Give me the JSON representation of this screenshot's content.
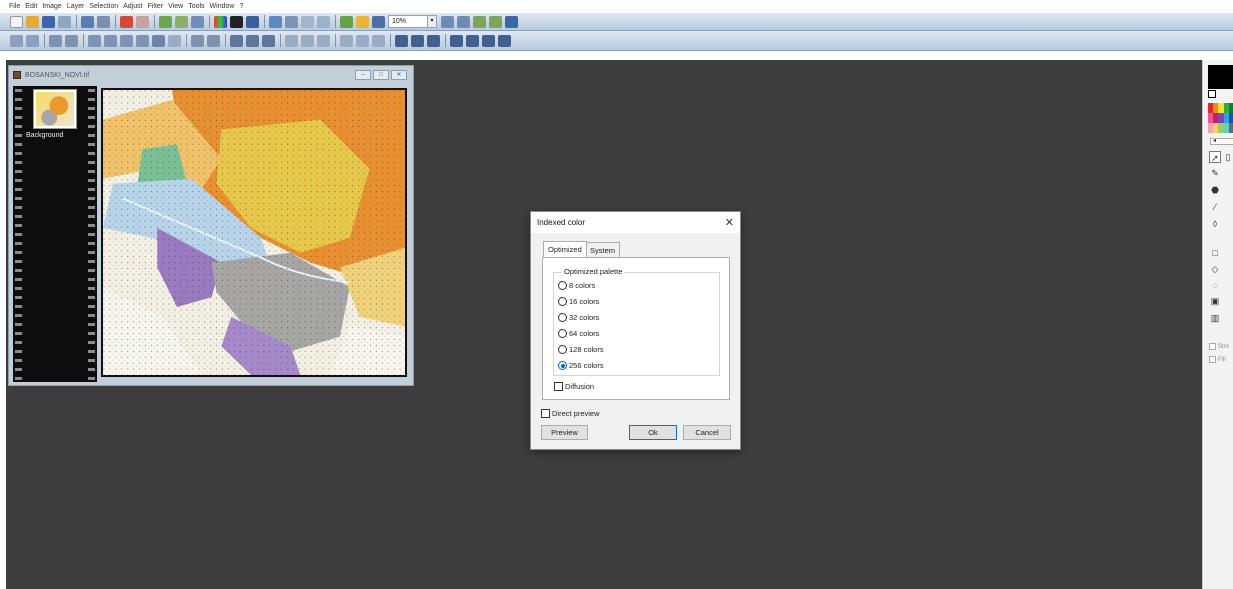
{
  "menu": [
    "File",
    "Edit",
    "Image",
    "Layer",
    "Selection",
    "Adjust",
    "Filter",
    "View",
    "Tools",
    "Window",
    "?"
  ],
  "toolbar": {
    "zoom_value": "10%"
  },
  "document": {
    "title": "BOSANSKI_NOVI.tif",
    "layer_name": "Background"
  },
  "dialog": {
    "title": "Indexed color",
    "tabs": [
      "Optimized",
      "System"
    ],
    "group_label": "Optimized palette",
    "options": [
      {
        "label": "8 colors",
        "checked": false
      },
      {
        "label": "16 colors",
        "checked": false
      },
      {
        "label": "32 colors",
        "checked": false
      },
      {
        "label": "64 colors",
        "checked": false
      },
      {
        "label": "128 colors",
        "checked": false
      },
      {
        "label": "256 colors",
        "checked": true
      }
    ],
    "diffusion_label": "Diffusion",
    "direct_preview_label": "Direct preview",
    "preview_button": "Preview",
    "ok_button": "Ok",
    "cancel_button": "Cancel"
  },
  "tools_panel": {
    "stroke_label": "Stro",
    "fill_label": "Fill"
  },
  "colors": {
    "workspace": "#3d3d3d",
    "accent": "#0a64c8"
  }
}
